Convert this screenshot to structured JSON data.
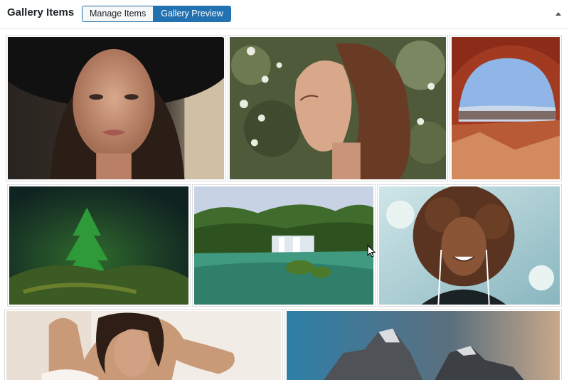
{
  "header": {
    "title": "Gallery Items",
    "tabs": [
      {
        "label": "Manage Items",
        "active": false
      },
      {
        "label": "Gallery Preview",
        "active": true
      }
    ],
    "collapse_icon": "triangle-up-icon"
  },
  "colors": {
    "accent": "#2271b1",
    "border": "#dcdcde"
  },
  "gallery": {
    "items": [
      {
        "subject": "woman-black-hat-portrait"
      },
      {
        "subject": "woman-with-flowers"
      },
      {
        "subject": "red-rock-arch-canyon"
      },
      {
        "subject": "forest-sapling-moss"
      },
      {
        "subject": "waterfall-lake"
      },
      {
        "subject": "smiling-woman-curly-hair-earphones"
      },
      {
        "subject": "woman-hands-on-head"
      },
      {
        "subject": "mountain-peaks-sky"
      }
    ]
  }
}
